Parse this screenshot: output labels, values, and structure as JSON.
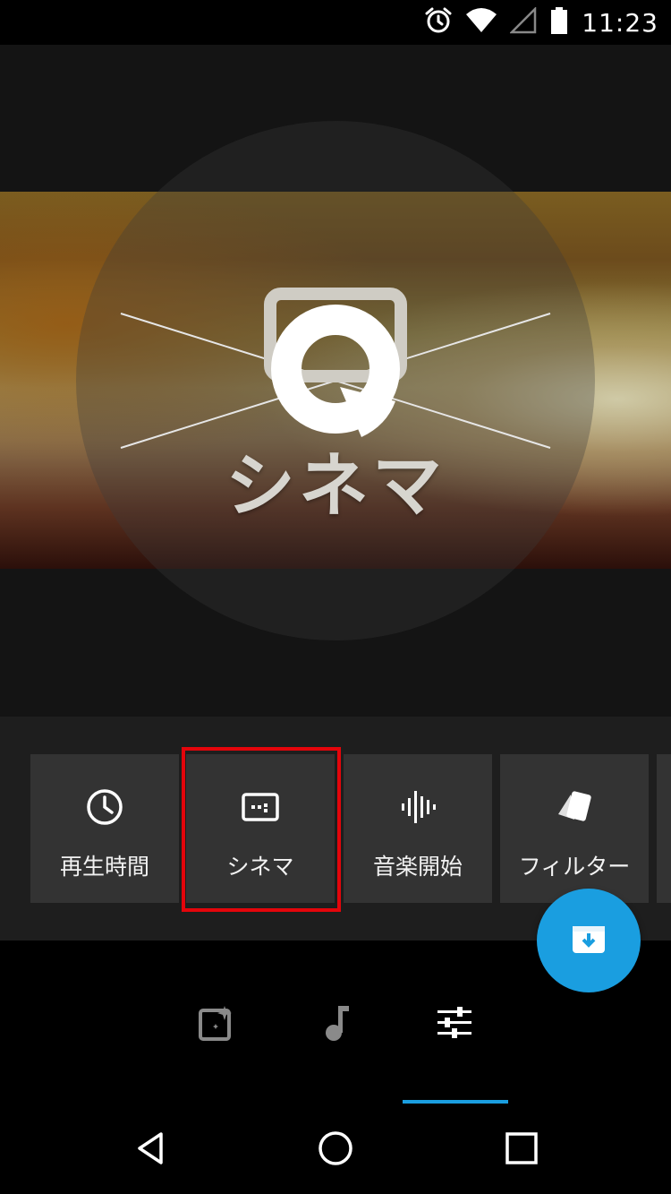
{
  "status_bar": {
    "time": "11:23",
    "icons": [
      "alarm-icon",
      "wifi-icon",
      "signal-icon",
      "battery-icon"
    ]
  },
  "preview": {
    "title": "シネマ",
    "icon": "cinema-theme-icon"
  },
  "options": [
    {
      "label": "再生時間",
      "icon": "clock-icon"
    },
    {
      "label": "シネマ",
      "icon": "cinema-icon",
      "highlighted": true
    },
    {
      "label": "音楽開始",
      "icon": "audio-wave-icon"
    },
    {
      "label": "フィルター",
      "icon": "filter-cards-icon"
    }
  ],
  "fab": {
    "icon": "save-download-icon"
  },
  "bottom_tabs": {
    "items": [
      {
        "icon": "theme-sparkle-icon"
      },
      {
        "icon": "music-note-icon"
      },
      {
        "icon": "settings-sliders-icon"
      }
    ],
    "active_index": 2,
    "accent_color": "#1a9ee0"
  },
  "nav": {
    "items": [
      {
        "icon": "back-icon"
      },
      {
        "icon": "home-icon"
      },
      {
        "icon": "recents-icon"
      }
    ]
  },
  "colors": {
    "highlight_box": "#e4050b",
    "fab": "#1a9ee0"
  }
}
